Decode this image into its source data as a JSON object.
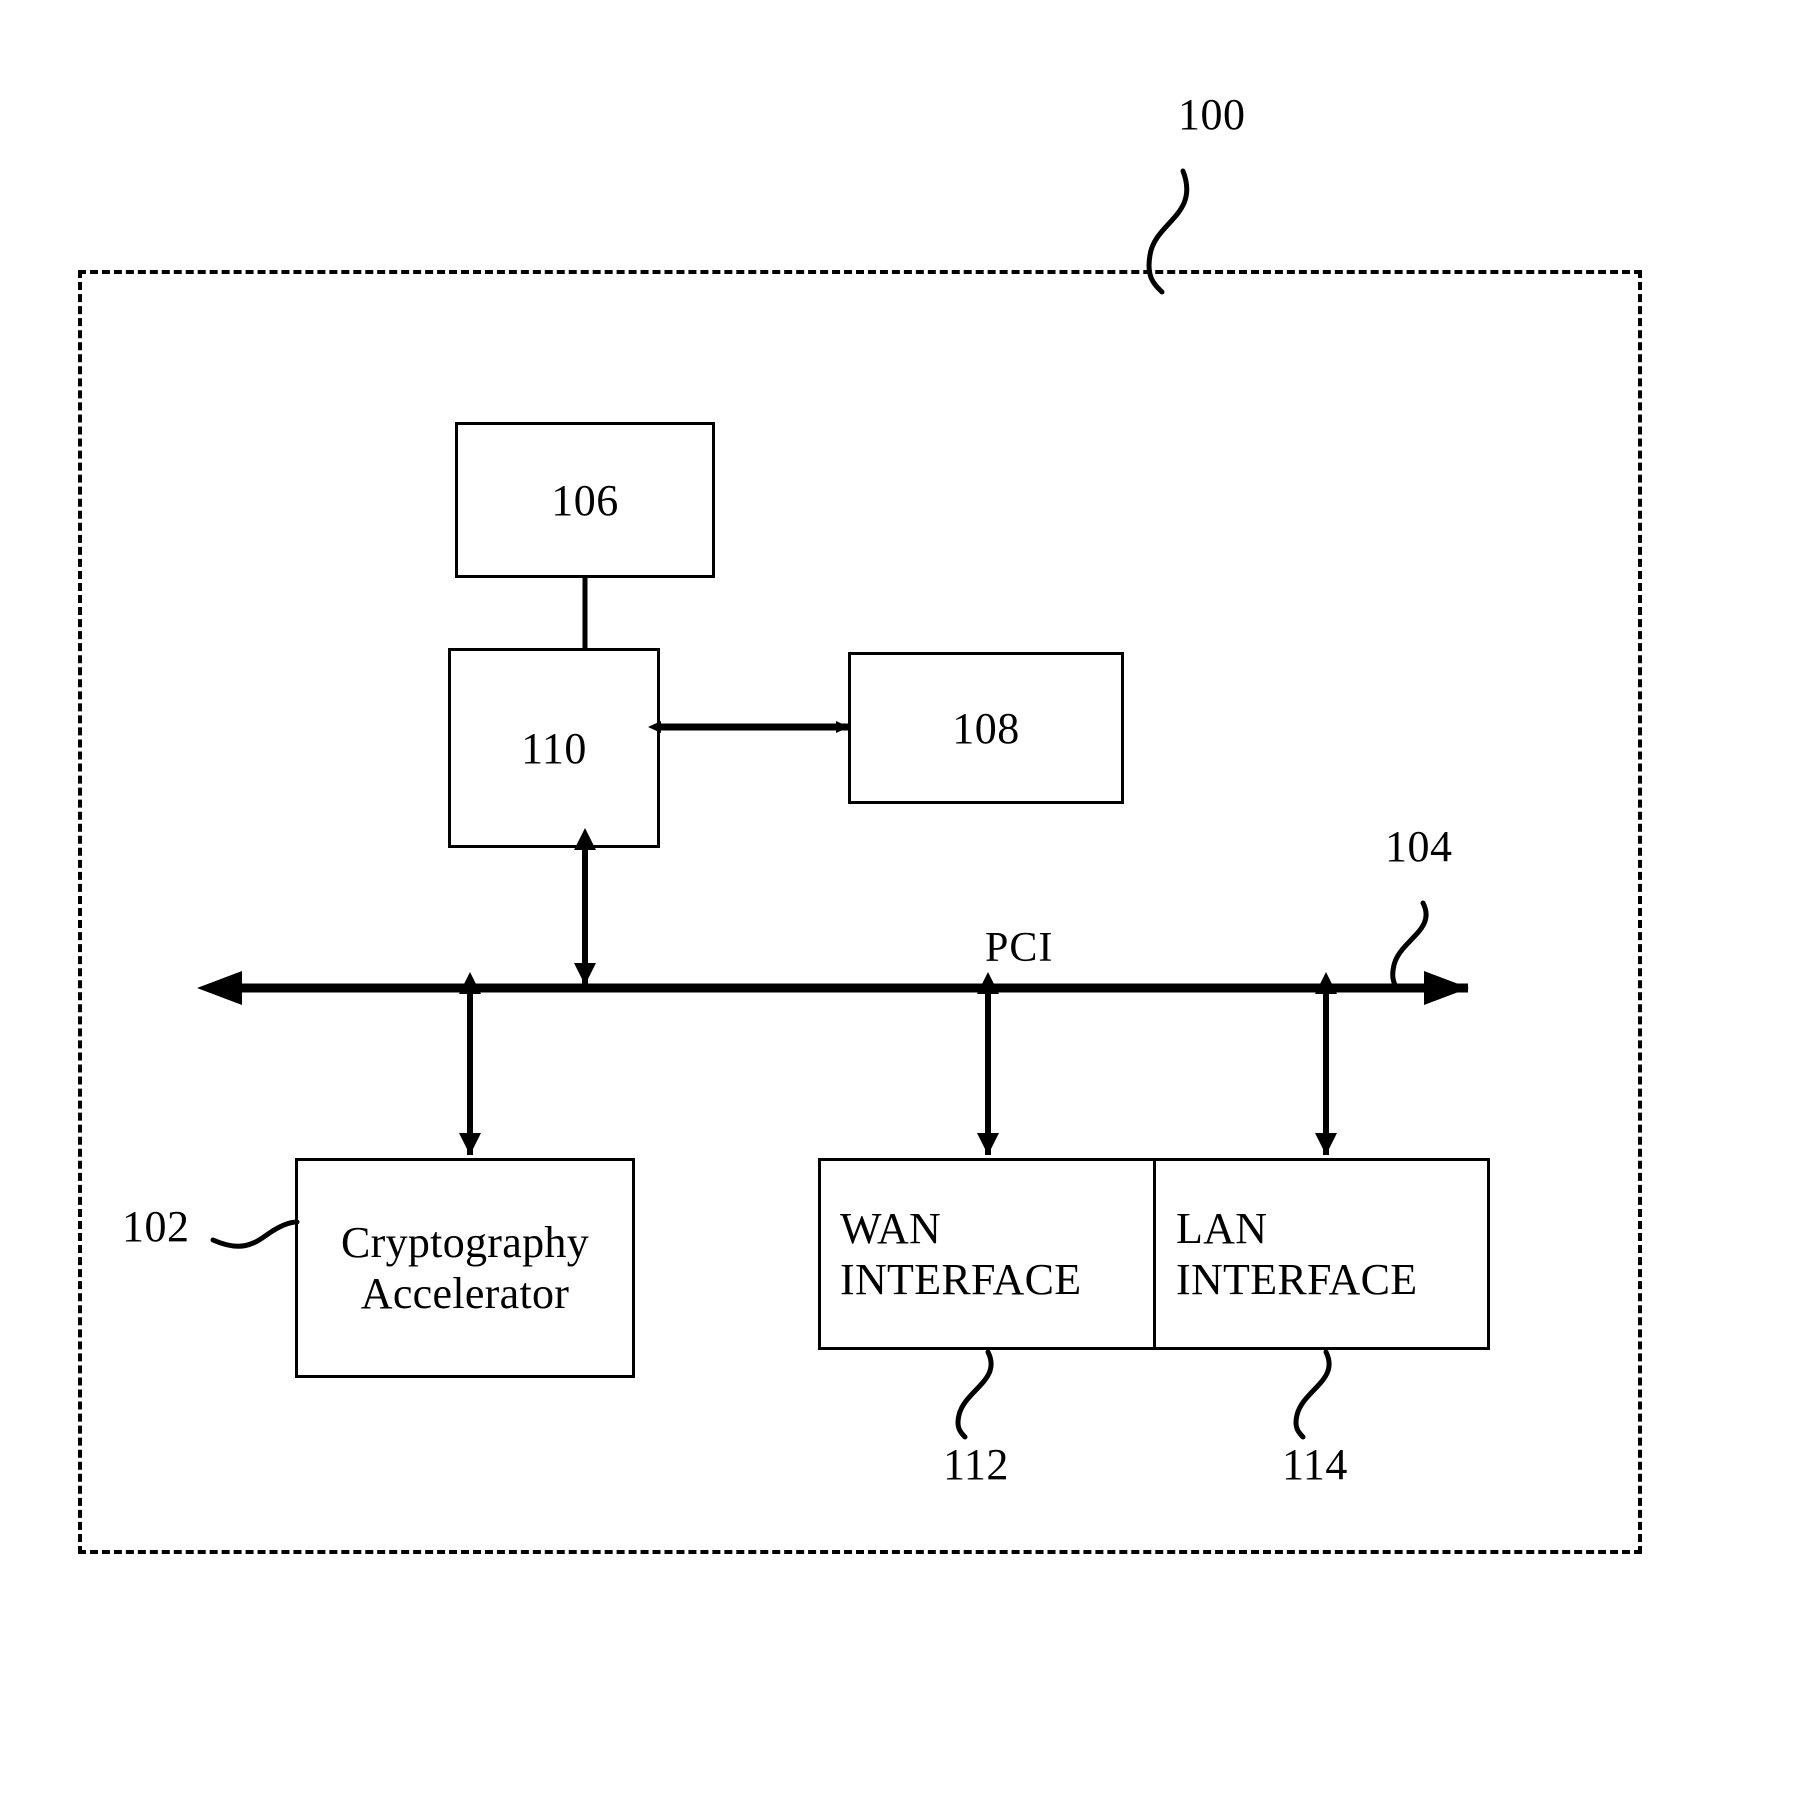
{
  "figure": {
    "type": "patent-block-diagram",
    "system_ref": "100",
    "bus_ref": "104",
    "bus_label": "PCI"
  },
  "blocks": {
    "b106": {
      "label": "106"
    },
    "b110": {
      "label": "110"
    },
    "b108": {
      "label": "108"
    },
    "crypto": {
      "ref": "102",
      "line1": "Cryptography",
      "line2": "Accelerator"
    },
    "wan": {
      "ref": "112",
      "line1": "WAN",
      "line2": "INTERFACE"
    },
    "lan": {
      "ref": "114",
      "line1": "LAN",
      "line2": "INTERFACE"
    }
  },
  "connections": [
    {
      "from": "106",
      "to": "110",
      "style": "plain-line",
      "orientation": "vertical"
    },
    {
      "from": "110",
      "to": "108",
      "style": "double-arrow",
      "orientation": "horizontal"
    },
    {
      "from": "110",
      "to": "PCI bus",
      "style": "double-arrow",
      "orientation": "vertical"
    },
    {
      "from": "Cryptography Accelerator",
      "to": "PCI bus",
      "style": "double-arrow",
      "orientation": "vertical"
    },
    {
      "from": "WAN INTERFACE",
      "to": "PCI bus",
      "style": "double-arrow",
      "orientation": "vertical"
    },
    {
      "from": "LAN INTERFACE",
      "to": "PCI bus",
      "style": "double-arrow",
      "orientation": "vertical"
    }
  ],
  "colors": {
    "ink": "#000000",
    "paper": "#ffffff"
  }
}
